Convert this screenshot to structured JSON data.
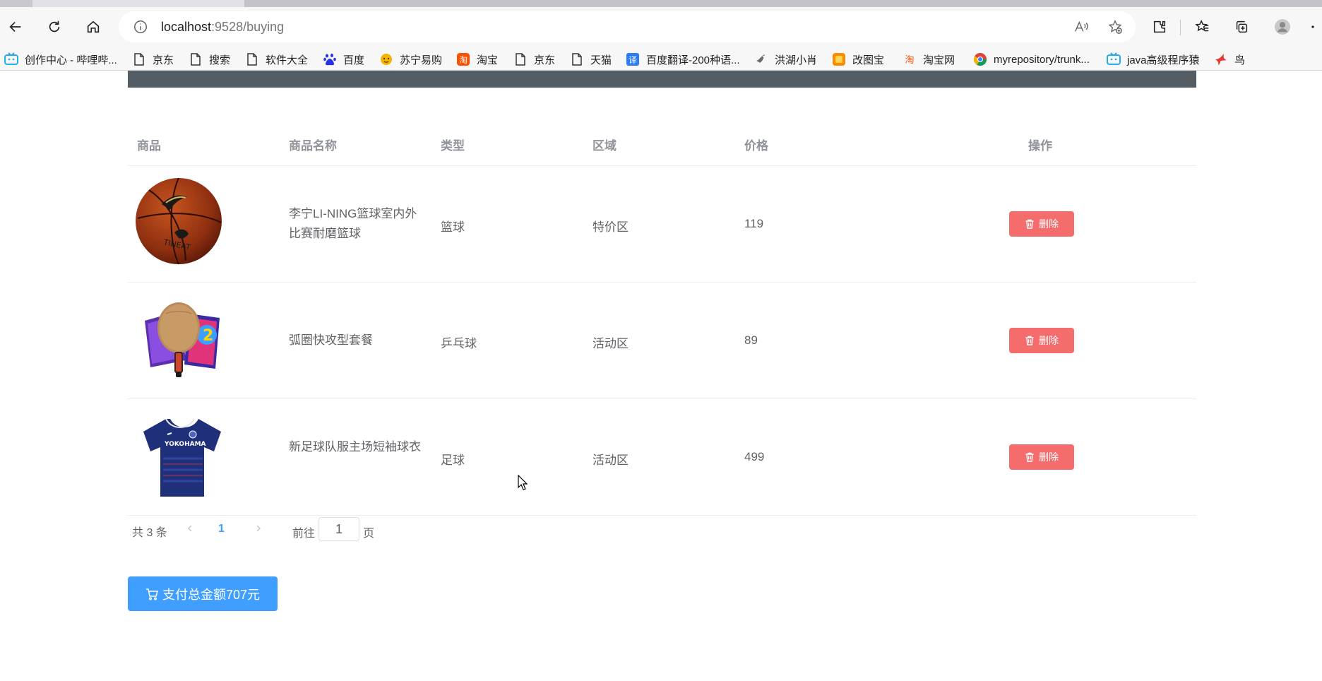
{
  "browser": {
    "url_host": "localhost",
    "url_rest": ":9528/buying",
    "bookmarks": [
      {
        "label": "创作中心 - 哔哩哔...",
        "icon": "bilibili-icon"
      },
      {
        "label": "京东",
        "icon": "page-icon"
      },
      {
        "label": "搜索",
        "icon": "page-icon"
      },
      {
        "label": "软件大全",
        "icon": "page-icon"
      },
      {
        "label": "百度",
        "icon": "baidu-icon"
      },
      {
        "label": "苏宁易购",
        "icon": "suning-icon"
      },
      {
        "label": "淘宝",
        "icon": "taobao-icon"
      },
      {
        "label": "京东",
        "icon": "page-icon"
      },
      {
        "label": "天猫",
        "icon": "page-icon"
      },
      {
        "label": "百度翻译-200种语...",
        "icon": "translate-icon"
      },
      {
        "label": "洪湖小肖",
        "icon": "bird-icon"
      },
      {
        "label": "改图宝",
        "icon": "gaitubao-icon"
      },
      {
        "label": "淘宝网",
        "icon": "taobao-icon"
      },
      {
        "label": "myrepository/trunk...",
        "icon": "chrome-icon"
      },
      {
        "label": "java高级程序猿",
        "icon": "bilibili-icon"
      },
      {
        "label": "鸟",
        "icon": "bird-icon"
      }
    ]
  },
  "table": {
    "headers": {
      "product": "商品",
      "name": "商品名称",
      "type": "类型",
      "region": "区域",
      "price": "价格",
      "action": "操作"
    },
    "rows": [
      {
        "image": "basketball",
        "name": "李宁LI-NING篮球室内外比赛耐磨篮球",
        "type": "篮球",
        "region": "特价区",
        "price": "119",
        "delete_label": "删除"
      },
      {
        "image": "ping-pong-paddle",
        "name": "弧圈快攻型套餐",
        "type": "乒乓球",
        "region": "活动区",
        "price": "89",
        "delete_label": "删除"
      },
      {
        "image": "football-jersey",
        "name": "新足球队服主场短袖球衣",
        "type": "足球",
        "region": "活动区",
        "price": "499",
        "delete_label": "删除"
      }
    ]
  },
  "pagination": {
    "total_text": "共 3 条",
    "current_page": "1",
    "goto_label": "前往",
    "goto_value": "1",
    "page_unit": "页"
  },
  "pay_button": {
    "label": "支付总金额707元"
  },
  "colors": {
    "header_band": "#545c64",
    "danger": "#f56c6c",
    "primary": "#409eff"
  }
}
